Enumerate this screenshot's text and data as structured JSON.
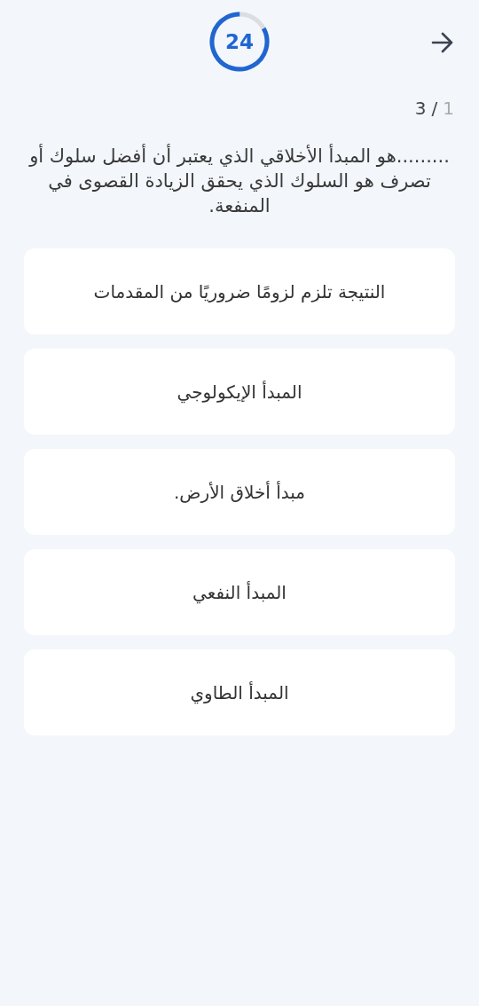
{
  "timer": {
    "value": "24",
    "level": 0.83
  },
  "counter": {
    "current": "1",
    "separator": "/",
    "total": "3"
  },
  "question": ".........هو المبدأ الأخلاقي الذي يعتبر أن أفضل سلوك أو تصرف هو السلوك الذي يحقق الزيادة القصوى في المنفعة.",
  "options": [
    {
      "label": "النتيجة تلزم لزومًا ضروريًا من المقدمات",
      "selected": false
    },
    {
      "label": "المبدأ الإيكولوجي",
      "selected": false
    },
    {
      "label": "مبدأ أخلاق الأرض.",
      "selected": false
    },
    {
      "label": "المبدأ النفعي",
      "selected": false
    },
    {
      "label": "المبدأ الطاوي",
      "selected": false
    }
  ]
}
